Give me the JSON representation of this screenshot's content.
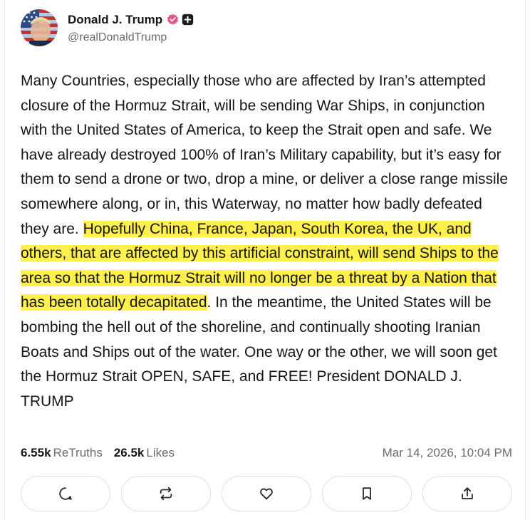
{
  "author": {
    "name": "Donald J. Trump",
    "handle": "@realDonaldTrump",
    "avatar": "avatar-image",
    "verified_badge": "verified-badge-icon",
    "plus_badge": "plus-badge-icon",
    "verified_color": "#e5557f"
  },
  "post": {
    "text_before": "Many Countries, especially those who are affected by Iran’s attempted closure of the Hormuz Strait, will be sending War Ships, in conjunction with the United States of America, to keep the Strait open and safe. We have already destroyed 100% of Iran’s Military capability, but it’s easy for them to send a drone or two, drop a mine, or deliver a close range missile somewhere along, or in, this Waterway, no matter how badly defeated they are. ",
    "text_highlighted": "Hopefully China, France, Japan, South Korea, the UK, and others, that are affected by this artificial constraint, will send Ships to the area so that the Hormuz Strait will no longer be a threat by a Nation that has been totally decapitated",
    "text_after": ". In the meantime, the United States will be bombing the hell out of the shoreline, and continually shooting Iranian Boats and Ships out of the water. One way or the other, we will soon get the Hormuz Strait OPEN, SAFE, and FREE! President DONALD J. TRUMP",
    "highlight_color": "#fff04d"
  },
  "stats": {
    "retruths_count": "6.55k",
    "retruths_label": "ReTruths",
    "likes_count": "26.5k",
    "likes_label": "Likes",
    "timestamp": "Mar 14, 2026, 10:04 PM"
  },
  "actions": [
    {
      "icon": "reply-icon"
    },
    {
      "icon": "retruth-icon"
    },
    {
      "icon": "like-icon"
    },
    {
      "icon": "bookmark-icon"
    },
    {
      "icon": "share-icon"
    }
  ]
}
